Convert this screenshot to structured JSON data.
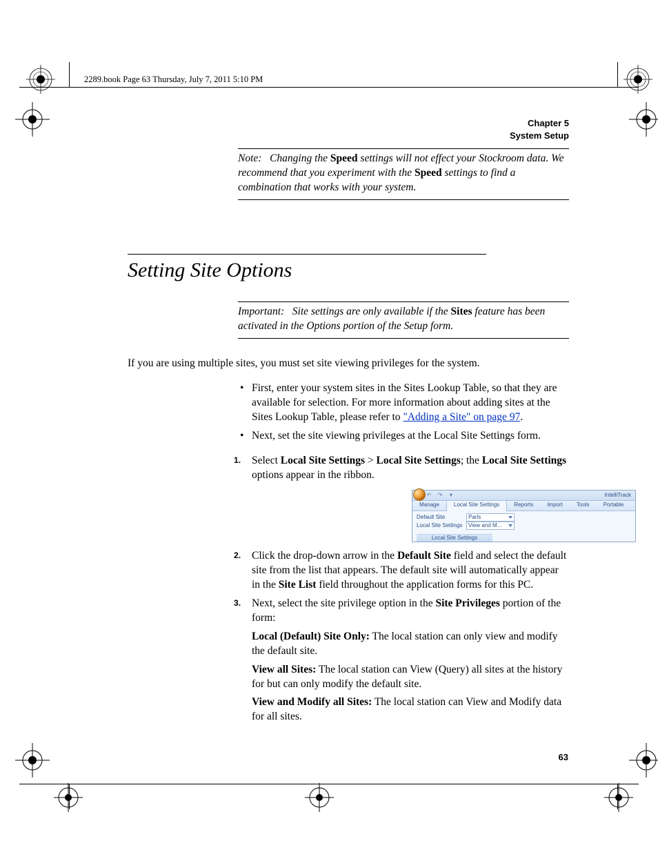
{
  "crop_header": "2289.book  Page 63  Thursday, July 7, 2011  5:10 PM",
  "runhead_line1": "Chapter 5",
  "runhead_line2": "System Setup",
  "note": {
    "label": "Note:",
    "t1": "Changing the ",
    "b1": "Speed",
    "t2": " settings will not effect your Stockroom data. We recommend that you experiment with the ",
    "b2": "Speed",
    "t3": " settings to find a combination that works with your system."
  },
  "section_title": "Setting Site Options",
  "important": {
    "label": "Important:",
    "t1": "Site settings are only available if the ",
    "b1": "Sites",
    "t2": " feature has been activated in the Options portion of the Setup form."
  },
  "intro": "If you are using multiple sites, you must set site viewing privileges for the system.",
  "bullet1_pre": "First, enter your system sites in the Sites Lookup Table, so that they are available for selection. For more information about adding sites at the Sites Lookup Table, please refer to ",
  "bullet1_link": "\"Adding a Site\" on page 97",
  "bullet1_post": ".",
  "bullet2": "Next, set the site viewing privileges at the Local Site Settings form.",
  "step1": {
    "t1": "Select ",
    "b1": "Local Site Settings",
    "sep": " > ",
    "b2": "Local Site Settings",
    "t2": "; the ",
    "b3": "Local Site Settings",
    "t3": " options appear in the ribbon."
  },
  "ribbon": {
    "title": "IntelliTrack",
    "tabs": [
      "Manage",
      "Local Site Settings",
      "Reports",
      "Import",
      "Tools",
      "Portable"
    ],
    "active_tab_index": 1,
    "row1_label": "Default Site",
    "row1_value": "Parls",
    "row2_label": "Local Site Settings",
    "row2_value": "View and M…",
    "group_label": "Local Site Settings"
  },
  "step2": {
    "t1": "Click the drop-down arrow in the ",
    "b1": "Default Site",
    "t2": " field and select the default site from the list that appears. The default site will automatically appear in the ",
    "b2": "Site List",
    "t3": " field throughout the application forms for this PC."
  },
  "step3": {
    "t1": "Next, select the site privilege option in the ",
    "b1": "Site Privileges",
    "t2": " portion of the form:",
    "opt1_b": "Local (Default) Site Only:",
    "opt1_t": " The local station can only view and modify the default site.",
    "opt2_b": "View all Sites:",
    "opt2_t": " The local station can View (Query) all sites at the history for but can only modify the default site.",
    "opt3_b": "View and Modify all Sites:",
    "opt3_t": " The local station can View and Modify data for all sites."
  },
  "page_number": "63"
}
